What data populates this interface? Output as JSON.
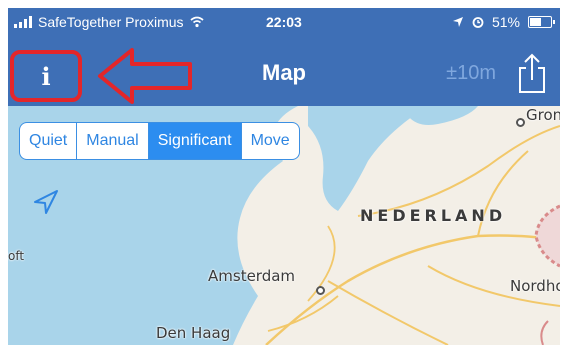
{
  "status_bar": {
    "carrier": "SafeTogether Proximus",
    "time": "22:03",
    "battery": "51%",
    "battery_level": 0.51
  },
  "nav": {
    "info_label": "i",
    "title": "Map",
    "accuracy": "±10m"
  },
  "mode_selector": {
    "options": [
      "Quiet",
      "Manual",
      "Significant",
      "Move"
    ],
    "selected": "Significant"
  },
  "map": {
    "labels": {
      "country": "NEDERLAND",
      "amsterdam": "Amsterdam",
      "den_haag": "Den Haag",
      "gron": "Gron",
      "nordhor": "Nordhor",
      "oft": "oft"
    }
  },
  "colors": {
    "nav_bar": "#3e6fb6",
    "highlight": "#e3262a",
    "segment_active": "#2c8df0",
    "water": "#a9d4ea",
    "land": "#f3efe7"
  }
}
